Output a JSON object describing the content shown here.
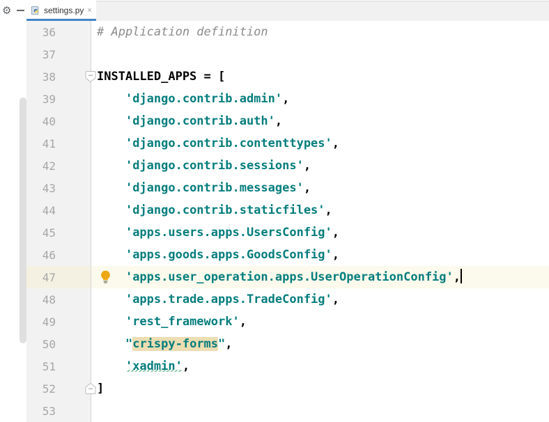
{
  "window": {
    "app": "code-editor"
  },
  "left_panel": {
    "gear_icon": "gear-settings",
    "hide_icon": "minus-hide",
    "scrollbar": {
      "visible": true
    }
  },
  "tab_bar": {
    "tabs": [
      {
        "label": "settings.py",
        "icon": "python-file-icon",
        "close_glyph": "×",
        "active": true
      }
    ]
  },
  "icons": {
    "gear_glyph": "⚙",
    "close_glyph": "×"
  },
  "editor": {
    "language": "python",
    "caret": {
      "line": 47,
      "after_text": "'apps.user_operation.apps.UserOperationConfig',"
    },
    "lines": [
      {
        "num": "36",
        "tokens": [
          {
            "type": "comment",
            "text": "# Application definition"
          }
        ]
      },
      {
        "num": "37",
        "tokens": []
      },
      {
        "num": "38",
        "fold": "open",
        "tokens": [
          {
            "type": "plain",
            "text": "INSTALLED_APPS = ["
          }
        ]
      },
      {
        "num": "39",
        "tokens": [
          {
            "type": "plain",
            "text": "    "
          },
          {
            "type": "string",
            "text": "'django.contrib.admin'"
          },
          {
            "type": "plain",
            "text": ","
          }
        ]
      },
      {
        "num": "40",
        "tokens": [
          {
            "type": "plain",
            "text": "    "
          },
          {
            "type": "string",
            "text": "'django.contrib.auth'"
          },
          {
            "type": "plain",
            "text": ","
          }
        ]
      },
      {
        "num": "41",
        "tokens": [
          {
            "type": "plain",
            "text": "    "
          },
          {
            "type": "string",
            "text": "'django.contrib.contenttypes'"
          },
          {
            "type": "plain",
            "text": ","
          }
        ]
      },
      {
        "num": "42",
        "tokens": [
          {
            "type": "plain",
            "text": "    "
          },
          {
            "type": "string",
            "text": "'django.contrib.sessions'"
          },
          {
            "type": "plain",
            "text": ","
          }
        ]
      },
      {
        "num": "43",
        "tokens": [
          {
            "type": "plain",
            "text": "    "
          },
          {
            "type": "string",
            "text": "'django.contrib.messages'"
          },
          {
            "type": "plain",
            "text": ","
          }
        ]
      },
      {
        "num": "44",
        "tokens": [
          {
            "type": "plain",
            "text": "    "
          },
          {
            "type": "string",
            "text": "'django.contrib.staticfiles'"
          },
          {
            "type": "plain",
            "text": ","
          }
        ]
      },
      {
        "num": "45",
        "tokens": [
          {
            "type": "plain",
            "text": "    "
          },
          {
            "type": "string",
            "text": "'apps.users.apps.UsersConfig'"
          },
          {
            "type": "plain",
            "text": ","
          }
        ]
      },
      {
        "num": "46",
        "tokens": [
          {
            "type": "plain",
            "text": "    "
          },
          {
            "type": "string",
            "text": "'apps.goods.apps.GoodsConfig'"
          },
          {
            "type": "plain",
            "text": ","
          }
        ]
      },
      {
        "num": "47",
        "current": true,
        "bulb": true,
        "caret": true,
        "tokens": [
          {
            "type": "plain",
            "text": "    "
          },
          {
            "type": "string",
            "text": "'apps.user_operation.apps.UserOperationConfig'"
          },
          {
            "type": "plain",
            "text": ","
          }
        ]
      },
      {
        "num": "48",
        "tokens": [
          {
            "type": "plain",
            "text": "    "
          },
          {
            "type": "string",
            "text": "'apps.trade.apps.TradeConfig'"
          },
          {
            "type": "plain",
            "text": ","
          }
        ]
      },
      {
        "num": "49",
        "tokens": [
          {
            "type": "plain",
            "text": "    "
          },
          {
            "type": "string",
            "text": "'rest_framework'"
          },
          {
            "type": "plain",
            "text": ","
          }
        ]
      },
      {
        "num": "50",
        "tokens": [
          {
            "type": "plain",
            "text": "    "
          },
          {
            "type": "string",
            "text": "\""
          },
          {
            "type": "string",
            "text": "crispy-forms",
            "highlight": true
          },
          {
            "type": "string",
            "text": "\""
          },
          {
            "type": "plain",
            "text": ","
          }
        ]
      },
      {
        "num": "51",
        "tokens": [
          {
            "type": "plain",
            "text": "    "
          },
          {
            "type": "string",
            "text": "'xadmin'",
            "squiggle": true
          },
          {
            "type": "plain",
            "text": ","
          }
        ]
      },
      {
        "num": "52",
        "fold": "close",
        "tokens": [
          {
            "type": "plain",
            "text": "]"
          }
        ]
      },
      {
        "num": "53",
        "tokens": []
      }
    ]
  },
  "colors": {
    "accent_blue_tab_underline": "#4184c9",
    "string_teal": "#067d7d",
    "comment_gray": "#8b8b8b",
    "gutter_bg": "#f2f2f2",
    "gutter_border": "#d5d5d5",
    "current_line_bg": "#fcfaec",
    "current_line_gutter_bg": "#f5f1e2",
    "search_highlight_tan": "#ecddb2",
    "typo_squiggle_green": "#8fc9ae",
    "bulb_amber": "#eda712",
    "line_number_gray": "#a6a6a6",
    "tabbar_bg": "#f1f1f1"
  }
}
